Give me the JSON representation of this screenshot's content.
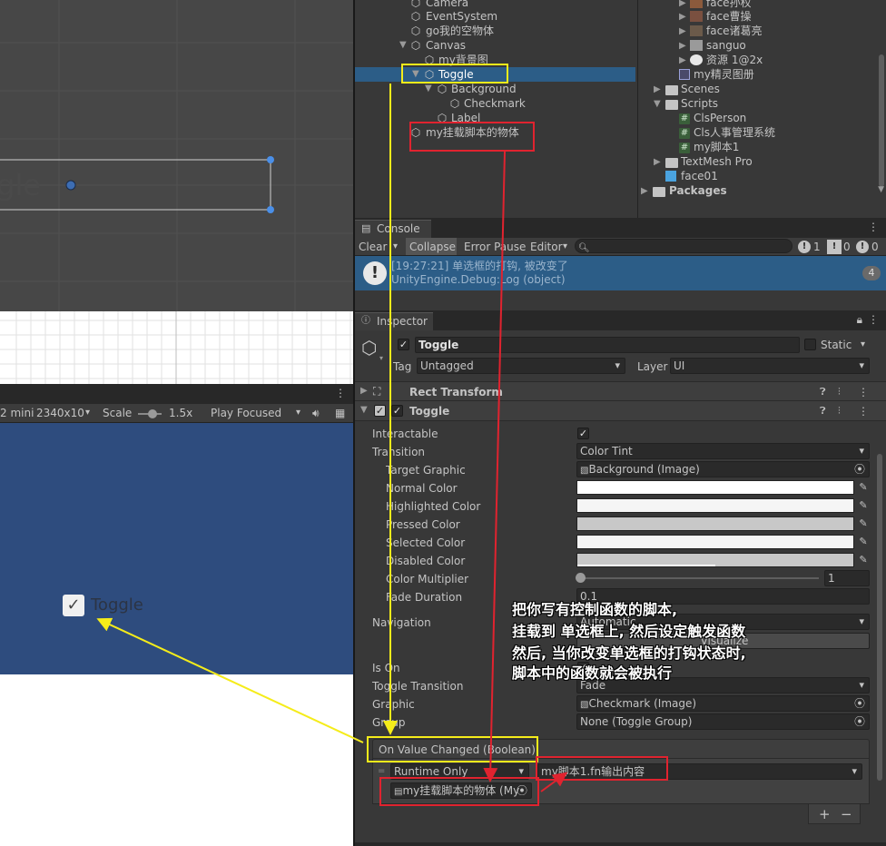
{
  "scene": {
    "toggle_text": "gle"
  },
  "game_toolbar": {
    "device": "2 mini",
    "resolution": "2340x10",
    "scale_label": "Scale",
    "scale_value": "1.5x",
    "play_mode": "Play Focused"
  },
  "game_view": {
    "toggle_label": "Toggle"
  },
  "hierarchy": {
    "items": [
      {
        "label": "Camera"
      },
      {
        "label": "EventSystem"
      },
      {
        "label": "go我的空物体"
      },
      {
        "label": "Canvas"
      },
      {
        "label": "my背景图"
      },
      {
        "label": "Toggle"
      },
      {
        "label": "Background"
      },
      {
        "label": "Checkmark"
      },
      {
        "label": "Label"
      },
      {
        "label": "my挂载脚本的物体"
      }
    ]
  },
  "project": {
    "items": [
      {
        "label": "face孙权"
      },
      {
        "label": "face曹操"
      },
      {
        "label": "face诸葛亮"
      },
      {
        "label": "sanguo"
      },
      {
        "label": "资源 1@2x"
      },
      {
        "label": "my精灵图册"
      },
      {
        "label": "Scenes"
      },
      {
        "label": "Scripts"
      },
      {
        "label": "ClsPerson"
      },
      {
        "label": "Cls人事管理系统"
      },
      {
        "label": "my脚本1"
      },
      {
        "label": "TextMesh Pro"
      },
      {
        "label": "face01"
      },
      {
        "label": "Packages"
      }
    ]
  },
  "console": {
    "tab": "Console",
    "clear": "Clear",
    "collapse": "Collapse",
    "error_pause": "Error Pause",
    "editor": "Editor",
    "count_info": "1",
    "count_warn": "0",
    "count_error": "0",
    "log_line1": "[19:27:21] 单选框的打钩, 被改变了",
    "log_line2": "UnityEngine.Debug:Log (object)",
    "log_count": "4"
  },
  "inspector": {
    "tab": "Inspector",
    "object_name": "Toggle",
    "static_label": "Static",
    "tag_label": "Tag",
    "tag_value": "Untagged",
    "layer_label": "Layer",
    "layer_value": "UI",
    "rect_transform": "Rect Transform",
    "toggle_component": "Toggle",
    "props": {
      "interactable": "Interactable",
      "transition": "Transition",
      "transition_value": "Color Tint",
      "target_graphic": "Target Graphic",
      "target_graphic_value": "Background (Image)",
      "normal_color": "Normal Color",
      "highlighted_color": "Highlighted Color",
      "pressed_color": "Pressed Color",
      "selected_color": "Selected Color",
      "disabled_color": "Disabled Color",
      "color_multiplier": "Color Multiplier",
      "color_multiplier_value": "1",
      "fade_duration": "Fade Duration",
      "fade_duration_value": "0.1",
      "navigation": "Navigation",
      "navigation_value": "Automatic",
      "visualize": "Visualize",
      "is_on": "Is On",
      "toggle_transition": "Toggle Transition",
      "toggle_transition_value": "Fade",
      "graphic": "Graphic",
      "graphic_value": "Checkmark (Image)",
      "group": "Group",
      "group_value": "None (Toggle Group)"
    },
    "event": {
      "header": "On Value Changed (Boolean)",
      "runtime": "Runtime Only",
      "function": "my脚本1.fn输出内容",
      "object": "my挂载脚本的物体 (My"
    }
  },
  "annotation": {
    "line1": "把你写有控制函数的脚本,",
    "line2": "挂载到 单选框上, 然后设定触发函数",
    "line3": "然后, 当你改变单选框的打钩状态时,",
    "line4": "脚本中的函数就会被执行"
  },
  "colors": {
    "highlight": "#2c5d87",
    "game_bg": "#2e4c7e",
    "annotation_red": "#e0232f",
    "annotation_yellow": "#f5ec1a"
  }
}
